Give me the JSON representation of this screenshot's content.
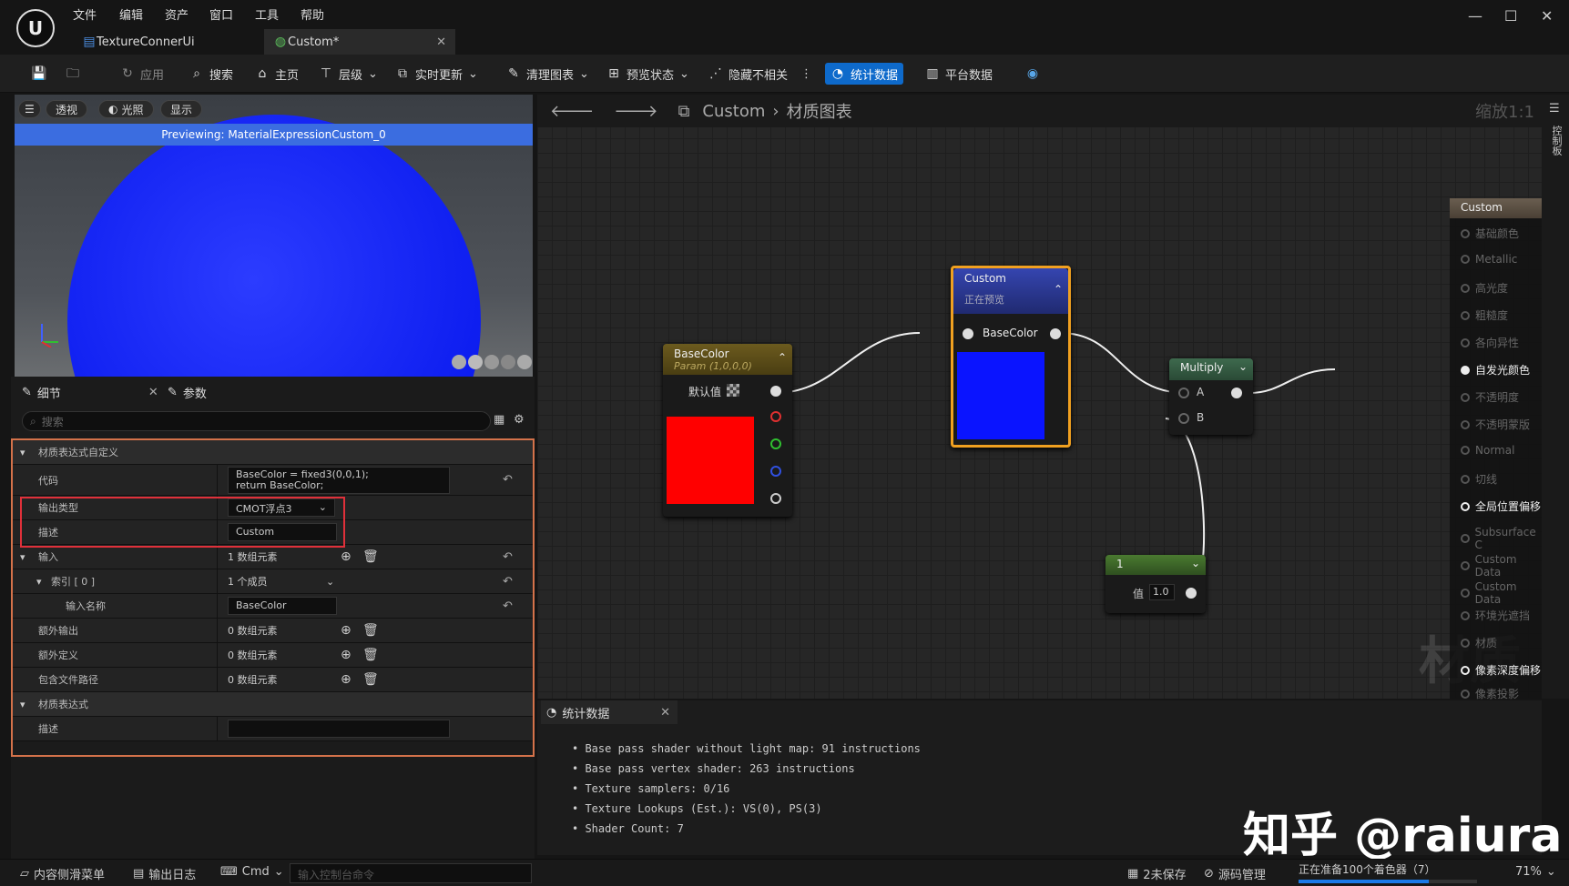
{
  "app": {
    "logo": "U",
    "menus": [
      "文件",
      "编辑",
      "资产",
      "窗口",
      "工具",
      "帮助"
    ],
    "tabs": [
      {
        "label": "TextureConnerUi"
      },
      {
        "label": "Custom*"
      }
    ]
  },
  "toolbar": {
    "apply": "应用",
    "search": "搜索",
    "home": "主页",
    "hierarchy": "层级",
    "live_update": "实时更新",
    "clean_graph": "清理图表",
    "preview_state": "预览状态",
    "hide_unrelated": "隐藏不相关",
    "stats": "统计数据",
    "platform_stats": "平台数据"
  },
  "viewport": {
    "perspective": "透视",
    "lit": "光照",
    "show": "显示",
    "banner": "Previewing: MaterialExpressionCustom_0"
  },
  "details": {
    "tab_details": "细节",
    "tab_params": "参数",
    "search_placeholder": "搜索",
    "cat_custom": "材质表达式自定义",
    "code_label": "代码",
    "code_line1": "BaseColor = fixed3(0,0,1);",
    "code_line2": "return BaseColor;",
    "output_type_label": "输出类型",
    "output_type_value": "CMOT浮点3",
    "desc_label": "描述",
    "desc_value": "Custom",
    "inputs_label": "输入",
    "inputs_value": "1 数组元素",
    "index_label": "索引 [ 0 ]",
    "index_value": "1 个成员",
    "input_name_label": "输入名称",
    "input_name_value": "BaseColor",
    "extra_out_label": "额外输出",
    "extra_out_value": "0 数组元素",
    "extra_def_label": "额外定义",
    "extra_def_value": "0 数组元素",
    "include_label": "包含文件路径",
    "include_value": "0 数组元素",
    "cat_expr": "材质表达式",
    "desc2_label": "描述"
  },
  "graph": {
    "breadcrumb_1": "Custom",
    "breadcrumb_2": "材质图表",
    "zoom": "缩放1:1",
    "basecolor_node": {
      "title": "BaseColor",
      "subtitle": "Param (1,0,0,0)",
      "default": "默认值"
    },
    "custom_node": {
      "title": "Custom",
      "subtitle": "正在预览",
      "pin": "BaseColor"
    },
    "multiply_node": {
      "title": "Multiply",
      "a": "A",
      "b": "B"
    },
    "const_node": {
      "title": "1",
      "label": "值",
      "value": "1.0"
    },
    "result_node": {
      "title": "Custom",
      "pins": [
        "基础颜色",
        "Metallic",
        "高光度",
        "粗糙度",
        "各向异性",
        "自发光颜色",
        "不透明度",
        "不透明蒙版",
        "Normal",
        "切线",
        "全局位置偏移",
        "Subsurface C",
        "Custom Data",
        "Custom Data",
        "环境光遮挡",
        "材质",
        "像素深度偏移",
        "像素投影"
      ]
    },
    "watermark": "材质",
    "side_label": "控制板"
  },
  "stats": {
    "tab": "统计数据",
    "lines": [
      "Base pass shader without light map: 91 instructions",
      "Base pass vertex shader: 263 instructions",
      "Texture samplers: 0/16",
      "Texture Lookups (Est.): VS(0), PS(3)",
      "Shader Count: 7"
    ]
  },
  "statusbar": {
    "content_drawer": "内容侧滑菜单",
    "output_log": "输出日志",
    "cmd": "Cmd",
    "console_placeholder": "输入控制台命令",
    "unsaved": "2未保存",
    "source_control": "源码管理",
    "progress_text": "正在准备100个着色器（7）",
    "progress": 0.73,
    "percent": "71%"
  },
  "watermark": "知乎 @raiura",
  "colors": {
    "accent": "#0e6acb",
    "highlight_box": "#e0303a",
    "details_border": "#d4724a",
    "preview_blue": "#0d1df0",
    "red_swatch": "#ff0000"
  }
}
